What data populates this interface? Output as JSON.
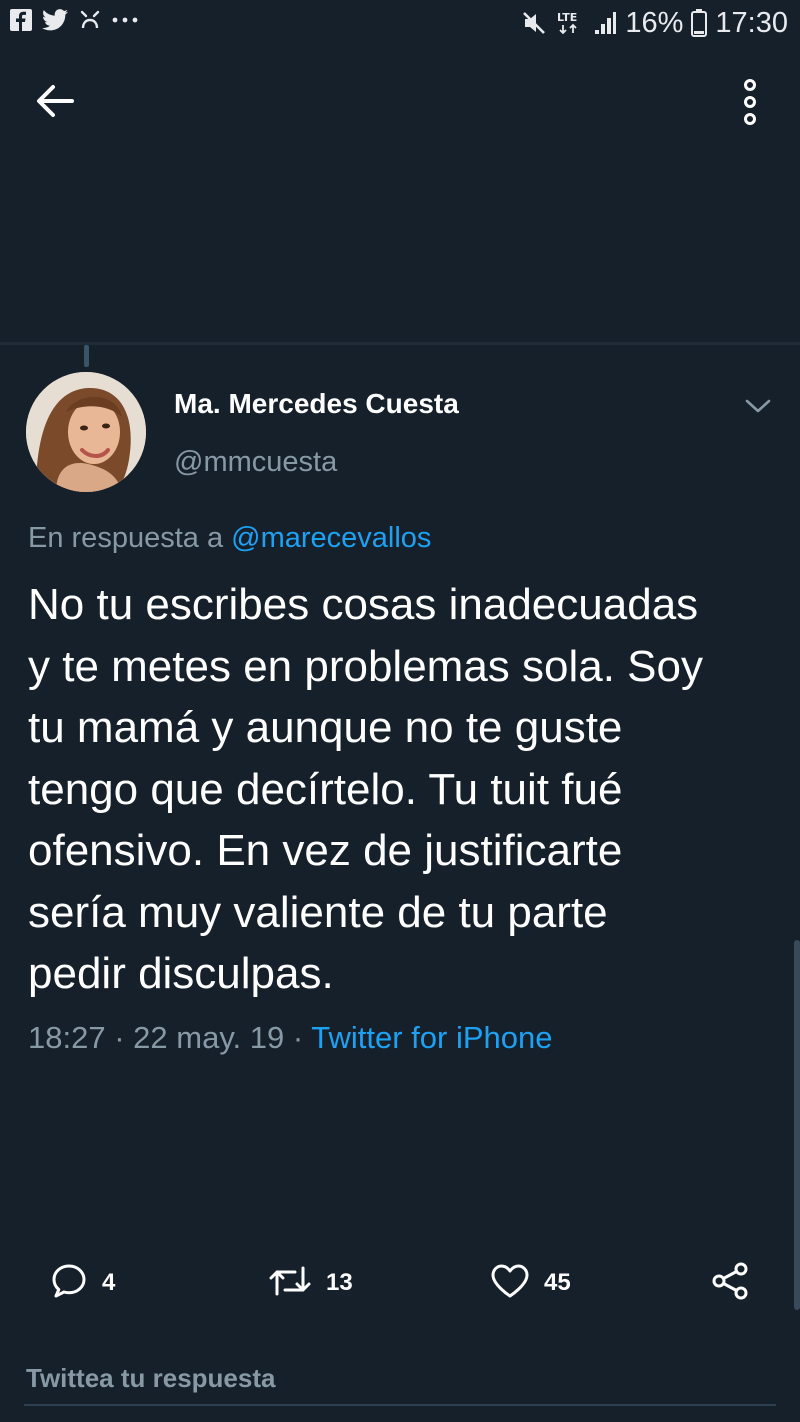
{
  "status_bar": {
    "battery_percent": "16%",
    "time": "17:30",
    "network": "LTE",
    "icons": [
      "facebook-icon",
      "twitter-icon",
      "notification-icon",
      "more-dots-icon",
      "mute-icon",
      "lte-icon",
      "signal-icon",
      "battery-icon"
    ]
  },
  "top_bar": {
    "back_icon": "arrow-left-icon",
    "more_icon": "vertical-dots-icon"
  },
  "tweet": {
    "author_name": "Ma. Mercedes Cuesta",
    "author_handle": "@mmcuesta",
    "reply_prefix": "En respuesta a",
    "reply_mention": "@marecevallos",
    "text_lines": [
      "No tu escribes cosas inadecuadas",
      "y te metes en problemas sola. Soy",
      "tu mamá y aunque no te guste",
      "tengo que decírtelo. Tu tuit fué",
      "ofensivo. En vez de justificarte",
      "sería muy valiente de tu parte",
      "pedir disculpas."
    ],
    "time": "18:27",
    "date": "22 may. 19",
    "separator": "·",
    "source": "Twitter for iPhone"
  },
  "actions": {
    "replies": "4",
    "retweets": "13",
    "likes": "45"
  },
  "reply_box": {
    "placeholder": "Twittea tu respuesta"
  },
  "colors": {
    "background": "#15202b",
    "accent": "#1da1f2",
    "secondary_text": "#8899a6"
  }
}
